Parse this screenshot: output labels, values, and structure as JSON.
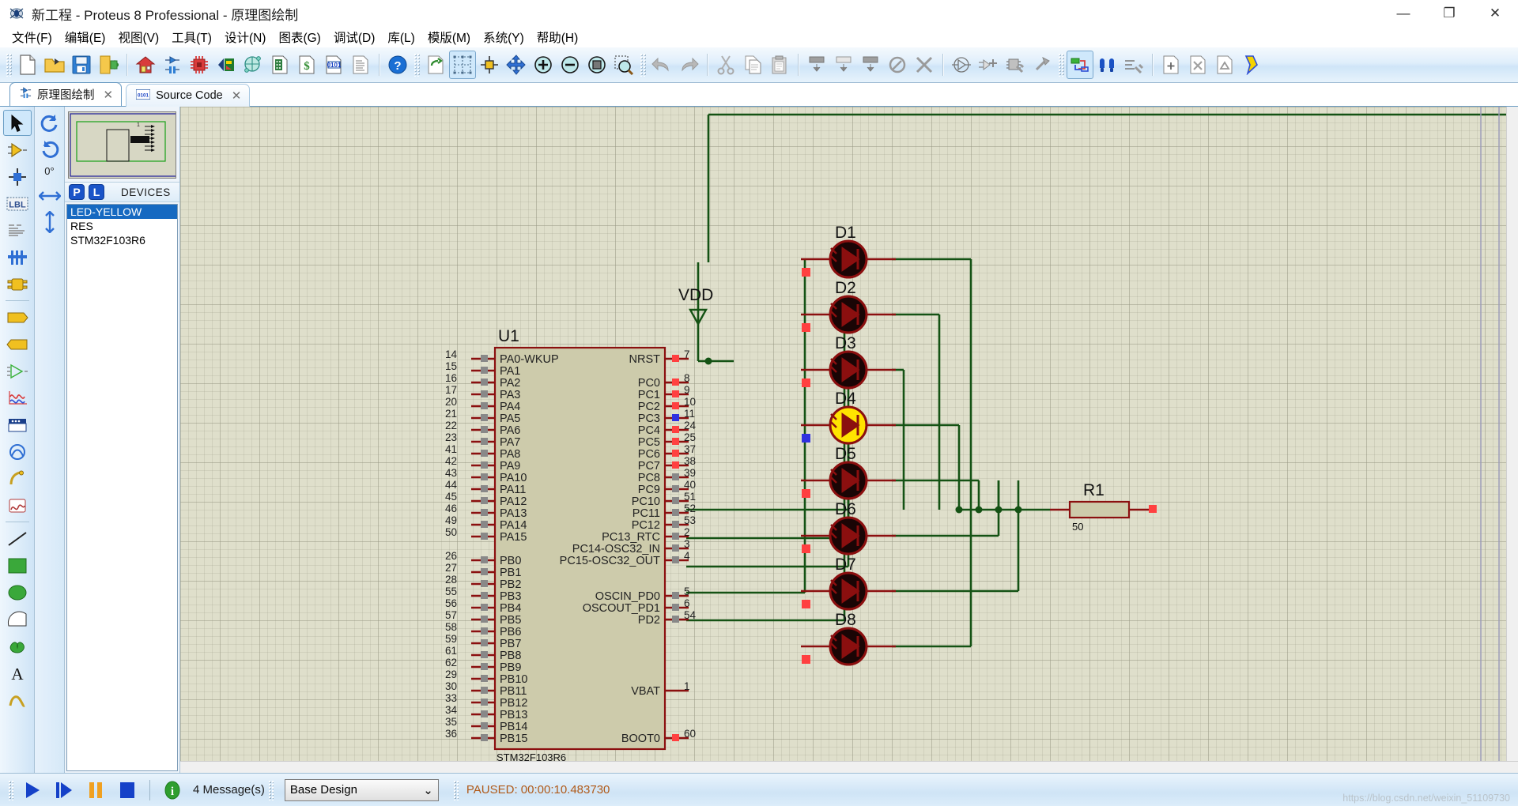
{
  "window": {
    "title": "新工程 - Proteus 8 Professional - 原理图绘制",
    "app_icon": "proteus-logo-icon",
    "minimize": "—",
    "maximize": "❐",
    "close": "✕"
  },
  "menu": {
    "items": [
      {
        "label": "文件(F)",
        "name": "menu-file"
      },
      {
        "label": "编辑(E)",
        "name": "menu-edit"
      },
      {
        "label": "视图(V)",
        "name": "menu-view"
      },
      {
        "label": "工具(T)",
        "name": "menu-tools"
      },
      {
        "label": "设计(N)",
        "name": "menu-design"
      },
      {
        "label": "图表(G)",
        "name": "menu-graph"
      },
      {
        "label": "调试(D)",
        "name": "menu-debug"
      },
      {
        "label": "库(L)",
        "name": "menu-library"
      },
      {
        "label": "模版(M)",
        "name": "menu-template"
      },
      {
        "label": "系统(Y)",
        "name": "menu-system"
      },
      {
        "label": "帮助(H)",
        "name": "menu-help"
      }
    ]
  },
  "toolbar": {
    "groups": [
      [
        "new-file-icon",
        "open-folder-icon",
        "save-icon",
        "export-icon"
      ],
      [
        "home-icon",
        "schematic-capture-icon",
        "pcb-layout-icon",
        "3d-visualizer-icon",
        "design-explorer-icon"
      ],
      [
        "bill-of-materials-icon",
        "bom-cost-icon",
        "source-code-icon",
        "report-icon"
      ],
      [
        "help-icon"
      ],
      [
        "redraw-icon",
        "toggle-grid-icon",
        "origin-icon",
        "pan-icon",
        "zoom-in-icon",
        "zoom-out-icon",
        "zoom-all-icon",
        "zoom-area-icon"
      ],
      [
        "undo-icon",
        "redo-icon"
      ],
      [
        "cut-icon",
        "copy-icon",
        "paste-icon"
      ],
      [
        "block-copy-icon",
        "block-move-icon",
        "block-rotate-icon",
        "block-delete-icon"
      ],
      [
        "pick-device-icon",
        "make-device-icon",
        "packaging-tool-icon",
        "decompose-icon"
      ],
      [
        "netlist-icon",
        "electrical-rule-check-icon",
        "netlist-compiler-icon"
      ],
      [
        "new-sheet-icon",
        "remove-sheet-icon",
        "exit-sheet-icon",
        "bill-materials-icon"
      ]
    ]
  },
  "tabs": [
    {
      "label": "原理图绘制",
      "icon": "schematic-icon",
      "close": "✕",
      "active": true
    },
    {
      "label": "Source Code",
      "icon": "source-code-icon",
      "close": "✕",
      "active": false
    }
  ],
  "left_tools": {
    "items": [
      {
        "name": "selection-mode-icon",
        "selected": true
      },
      {
        "name": "component-mode-icon",
        "selected": false
      },
      {
        "name": "junction-dot-mode-icon",
        "selected": false
      },
      {
        "name": "wire-label-mode-icon",
        "selected": false
      },
      {
        "name": "text-script-mode-icon",
        "selected": false
      },
      {
        "name": "buses-mode-icon",
        "selected": false
      },
      {
        "name": "subcircuit-mode-icon",
        "selected": false
      },
      {
        "name": "terminals-mode-icon",
        "selected": false
      },
      {
        "name": "device-pins-mode-icon",
        "selected": false
      },
      {
        "name": "graph-mode-icon",
        "selected": false
      },
      {
        "name": "tape-recorder-mode-icon",
        "selected": false
      },
      {
        "name": "generator-mode-icon",
        "selected": false
      },
      {
        "name": "voltage-probe-mode-icon",
        "selected": false
      },
      {
        "name": "virtual-instruments-mode-icon",
        "selected": false
      },
      {
        "name": "line-tool-icon",
        "selected": false
      },
      {
        "name": "box-tool-icon",
        "selected": false
      },
      {
        "name": "circle-tool-icon",
        "selected": false
      },
      {
        "name": "arc-tool-icon",
        "selected": false
      },
      {
        "name": "closed-path-tool-icon",
        "selected": false
      },
      {
        "name": "text-tool-icon",
        "selected": false
      },
      {
        "name": "symbol-tool-icon",
        "selected": false
      }
    ]
  },
  "rotation": {
    "rotate_cw_icon": "rotate-clockwise-icon",
    "rotate_ccw_icon": "rotate-counterclockwise-icon",
    "angle": "0°",
    "mirror_x_icon": "mirror-horizontal-icon",
    "mirror_y_icon": "mirror-vertical-icon"
  },
  "devices_panel": {
    "pick_button": "P",
    "library_button": "L",
    "header": "DEVICES",
    "items": [
      {
        "label": "LED-YELLOW",
        "selected": true
      },
      {
        "label": "RES",
        "selected": false
      },
      {
        "label": "STM32F103R6",
        "selected": false
      }
    ]
  },
  "schematic": {
    "mcu": {
      "ref": "U1",
      "part": "STM32F103R6",
      "left_pins": [
        {
          "num": "14",
          "name": "PA0-WKUP"
        },
        {
          "num": "15",
          "name": "PA1"
        },
        {
          "num": "16",
          "name": "PA2"
        },
        {
          "num": "17",
          "name": "PA3"
        },
        {
          "num": "20",
          "name": "PA4"
        },
        {
          "num": "21",
          "name": "PA5"
        },
        {
          "num": "22",
          "name": "PA6"
        },
        {
          "num": "23",
          "name": "PA7"
        },
        {
          "num": "41",
          "name": "PA8"
        },
        {
          "num": "42",
          "name": "PA9"
        },
        {
          "num": "43",
          "name": "PA10"
        },
        {
          "num": "44",
          "name": "PA11"
        },
        {
          "num": "45",
          "name": "PA12"
        },
        {
          "num": "46",
          "name": "PA13"
        },
        {
          "num": "49",
          "name": "PA14"
        },
        {
          "num": "50",
          "name": "PA15"
        },
        {
          "num": "26",
          "name": "PB0"
        },
        {
          "num": "27",
          "name": "PB1"
        },
        {
          "num": "28",
          "name": "PB2"
        },
        {
          "num": "55",
          "name": "PB3"
        },
        {
          "num": "56",
          "name": "PB4"
        },
        {
          "num": "57",
          "name": "PB5"
        },
        {
          "num": "58",
          "name": "PB6"
        },
        {
          "num": "59",
          "name": "PB7"
        },
        {
          "num": "61",
          "name": "PB8"
        },
        {
          "num": "62",
          "name": "PB9"
        },
        {
          "num": "29",
          "name": "PB10"
        },
        {
          "num": "30",
          "name": "PB11"
        },
        {
          "num": "33",
          "name": "PB12"
        },
        {
          "num": "34",
          "name": "PB13"
        },
        {
          "num": "35",
          "name": "PB14"
        },
        {
          "num": "36",
          "name": "PB15"
        }
      ],
      "right_pins": [
        {
          "num": "7",
          "name": "NRST"
        },
        {
          "num": "8",
          "name": "PC0"
        },
        {
          "num": "9",
          "name": "PC1"
        },
        {
          "num": "10",
          "name": "PC2"
        },
        {
          "num": "11",
          "name": "PC3"
        },
        {
          "num": "24",
          "name": "PC4"
        },
        {
          "num": "25",
          "name": "PC5"
        },
        {
          "num": "37",
          "name": "PC6"
        },
        {
          "num": "38",
          "name": "PC7"
        },
        {
          "num": "39",
          "name": "PC8"
        },
        {
          "num": "40",
          "name": "PC9"
        },
        {
          "num": "51",
          "name": "PC10"
        },
        {
          "num": "52",
          "name": "PC11"
        },
        {
          "num": "53",
          "name": "PC12"
        },
        {
          "num": "2",
          "name": "PC13_RTC"
        },
        {
          "num": "3",
          "name": "PC14-OSC32_IN"
        },
        {
          "num": "4",
          "name": "PC15-OSC32_OUT"
        },
        {
          "num": "5",
          "name": "OSCIN_PD0"
        },
        {
          "num": "6",
          "name": "OSCOUT_PD1"
        },
        {
          "num": "54",
          "name": "PD2"
        },
        {
          "num": "1",
          "name": "VBAT"
        },
        {
          "num": "60",
          "name": "BOOT0"
        }
      ]
    },
    "power": {
      "label": "VDD"
    },
    "leds": [
      {
        "ref": "D1",
        "lit": false
      },
      {
        "ref": "D2",
        "lit": false
      },
      {
        "ref": "D3",
        "lit": false
      },
      {
        "ref": "D4",
        "lit": true
      },
      {
        "ref": "D5",
        "lit": false
      },
      {
        "ref": "D6",
        "lit": false
      },
      {
        "ref": "D7",
        "lit": false
      },
      {
        "ref": "D8",
        "lit": false
      }
    ],
    "resistor": {
      "ref": "R1",
      "value": "50"
    }
  },
  "statusbar": {
    "play_icon": "play-icon",
    "step_icon": "step-icon",
    "pause_icon": "pause-icon",
    "stop_icon": "stop-icon",
    "info_icon": "info-icon",
    "messages": "4 Message(s)",
    "design_select": "Base Design",
    "design_select_chevron": "⌄",
    "sim_status": "PAUSED: 00:00:10.483730"
  },
  "watermark": "https://blog.csdn.net/weixin_51109730",
  "colors": {
    "accent_blue": "#1669c1",
    "canvas_bg": "#dfdfcb",
    "wire_green": "#145214",
    "component_red": "#8b0f0f",
    "led_lit_yellow": "#ffe400",
    "led_off": "#1a0505",
    "pin_red": "#ff4040",
    "pin_blue": "#3030e0",
    "pin_gray": "#888888",
    "paused_orange": "#b05a19"
  }
}
